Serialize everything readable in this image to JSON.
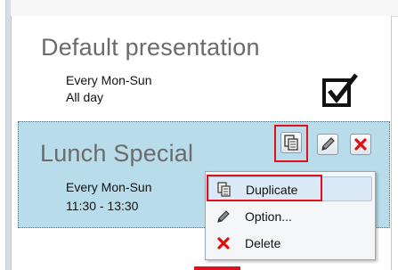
{
  "schedules": [
    {
      "title": "Default presentation",
      "days": "Every Mon-Sun",
      "time": "All day",
      "status_icon": "checkbox-checked-icon"
    },
    {
      "title": "Lunch Special",
      "days": "Every Mon-Sun",
      "time": "11:30 - 13:30",
      "actions": [
        {
          "name": "duplicate-icon",
          "label": "Duplicate"
        },
        {
          "name": "pencil-icon",
          "label": "Option"
        },
        {
          "name": "close-icon",
          "label": "Delete"
        }
      ]
    }
  ],
  "context_menu": {
    "items": [
      {
        "label": "Duplicate",
        "icon": "duplicate-icon"
      },
      {
        "label": "Option...",
        "icon": "pencil-icon"
      },
      {
        "label": "Delete",
        "icon": "red-x-icon"
      }
    ]
  },
  "colors": {
    "selected_card": "#b9dcea",
    "highlight": "#e0101a",
    "delete_red": "#e01010"
  }
}
